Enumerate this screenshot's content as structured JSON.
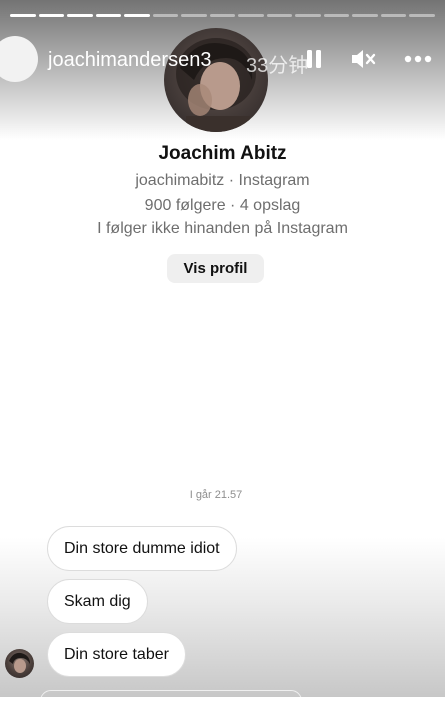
{
  "story": {
    "username": "joachimandersen3",
    "time_ago": "33分钟",
    "progress": {
      "segments": 15,
      "completed": 4,
      "current": 5
    }
  },
  "profile": {
    "name": "Joachim Abitz",
    "subtitle": "joachimabitz · Instagram",
    "stats": "900 følgere · 4 opslag",
    "relation": "I følger ikke hinanden på Instagram",
    "view_button": "Vis profil"
  },
  "chat": {
    "timestamp": "I går 21.57",
    "messages": [
      "Din store dumme idiot",
      "Skam dig",
      "Din store taber"
    ]
  },
  "icons": {
    "pause": "pause-icon",
    "mute": "mute-icon",
    "more": "more-icon"
  }
}
